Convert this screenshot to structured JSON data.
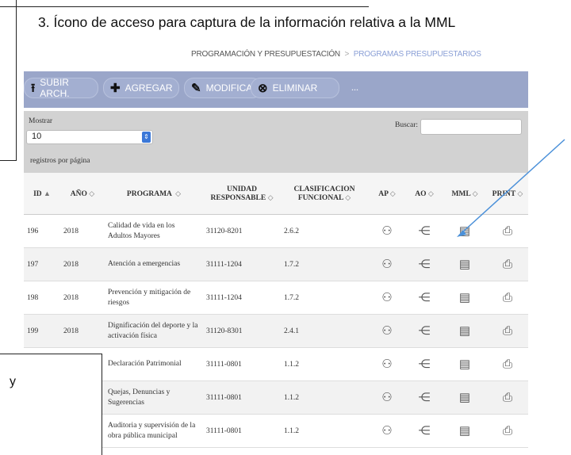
{
  "heading": "3.  Ícono de acceso  para  captura de la información relativa a la MML",
  "breadcrumb": {
    "section": "PROGRAMACIÓN Y PRESUPUESTACIÓN",
    "separator": ">",
    "current": "PROGRAMAS PRESUPUESTARIOS"
  },
  "toolbar": {
    "upload": "SUBIR ARCH.",
    "add": "AGREGAR",
    "edit": "MODIFICAR",
    "delete": "ELIMINAR",
    "more": "..."
  },
  "controls": {
    "show_label": "Mostrar",
    "page_size": "10",
    "per_page_label": "registros por página",
    "search_label": "Buscar:",
    "search_value": ""
  },
  "table": {
    "headers": [
      "ID",
      "AÑO",
      "PROGRAMA",
      "UNIDAD RESPONSABLE",
      "CLASIFICACION FUNCIONAL",
      "AP",
      "AO",
      "MML",
      "PRINT"
    ],
    "rows": [
      [
        "196",
        "2018",
        "Calidad de vida en los Adultos Mayores",
        "31120-8201",
        "2.6.2"
      ],
      [
        "197",
        "2018",
        "Atención a emergencias",
        "31111-1204",
        "1.7.2"
      ],
      [
        "198",
        "2018",
        "Prevención y mitigación de riesgos",
        "31111-1204",
        "1.7.2"
      ],
      [
        "199",
        "2018",
        "Dignificación del deporte y la activación física",
        "31120-8301",
        "2.4.1"
      ],
      [
        "",
        "",
        "Declaración Patrimonial",
        "31111-0801",
        "1.1.2"
      ],
      [
        "",
        "",
        "Quejas, Denuncias y Sugerencias",
        "31111-0801",
        "1.1.2"
      ],
      [
        "",
        "",
        "Auditoria y supervisión de la obra pública municipal",
        "31111-0801",
        "1.1.2"
      ]
    ]
  },
  "overlay_text": "y",
  "colors": {
    "toolbar": "#9aa6c9",
    "controls": "#d2d2d2",
    "arrow": "#4a90d9",
    "breadcrumb_current": "#8a9fd6"
  },
  "icons": {
    "ap": "org-chart-icon",
    "ao": "tree-icon",
    "mml": "notebook-icon",
    "print": "printer-icon"
  }
}
